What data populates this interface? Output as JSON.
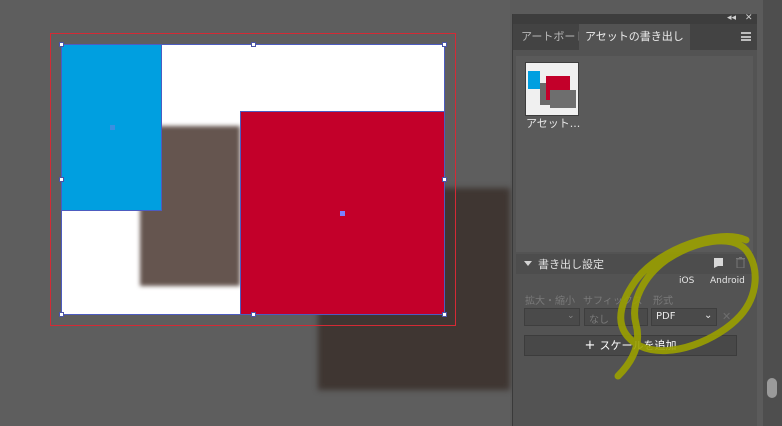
{
  "panel": {
    "tabs": [
      {
        "label": "アートボード",
        "active": false
      },
      {
        "label": "アセットの書き出し",
        "active": true
      }
    ],
    "asset_label": "アセット...",
    "export_settings": {
      "title": "書き出し設定",
      "platform_ios": "iOS",
      "platform_android": "Android",
      "col_scale": "拡大・縮小",
      "col_suffix": "サフィックス",
      "col_format": "形式",
      "suffix_placeholder": "なし",
      "format_value": "PDF",
      "add_scale_label": "スケールを追加"
    },
    "icons": {
      "collapse": "double-chevron-icon",
      "close": "close-icon",
      "menu": "hamburger-icon",
      "tablet": "tablet-icon",
      "trash": "trash-icon",
      "remove": "x-icon"
    }
  },
  "colors": {
    "blue_shape": "#009fe0",
    "red_shape": "#c3002a",
    "artboard_border": "#d42a35",
    "annotation": "#9aa000"
  }
}
